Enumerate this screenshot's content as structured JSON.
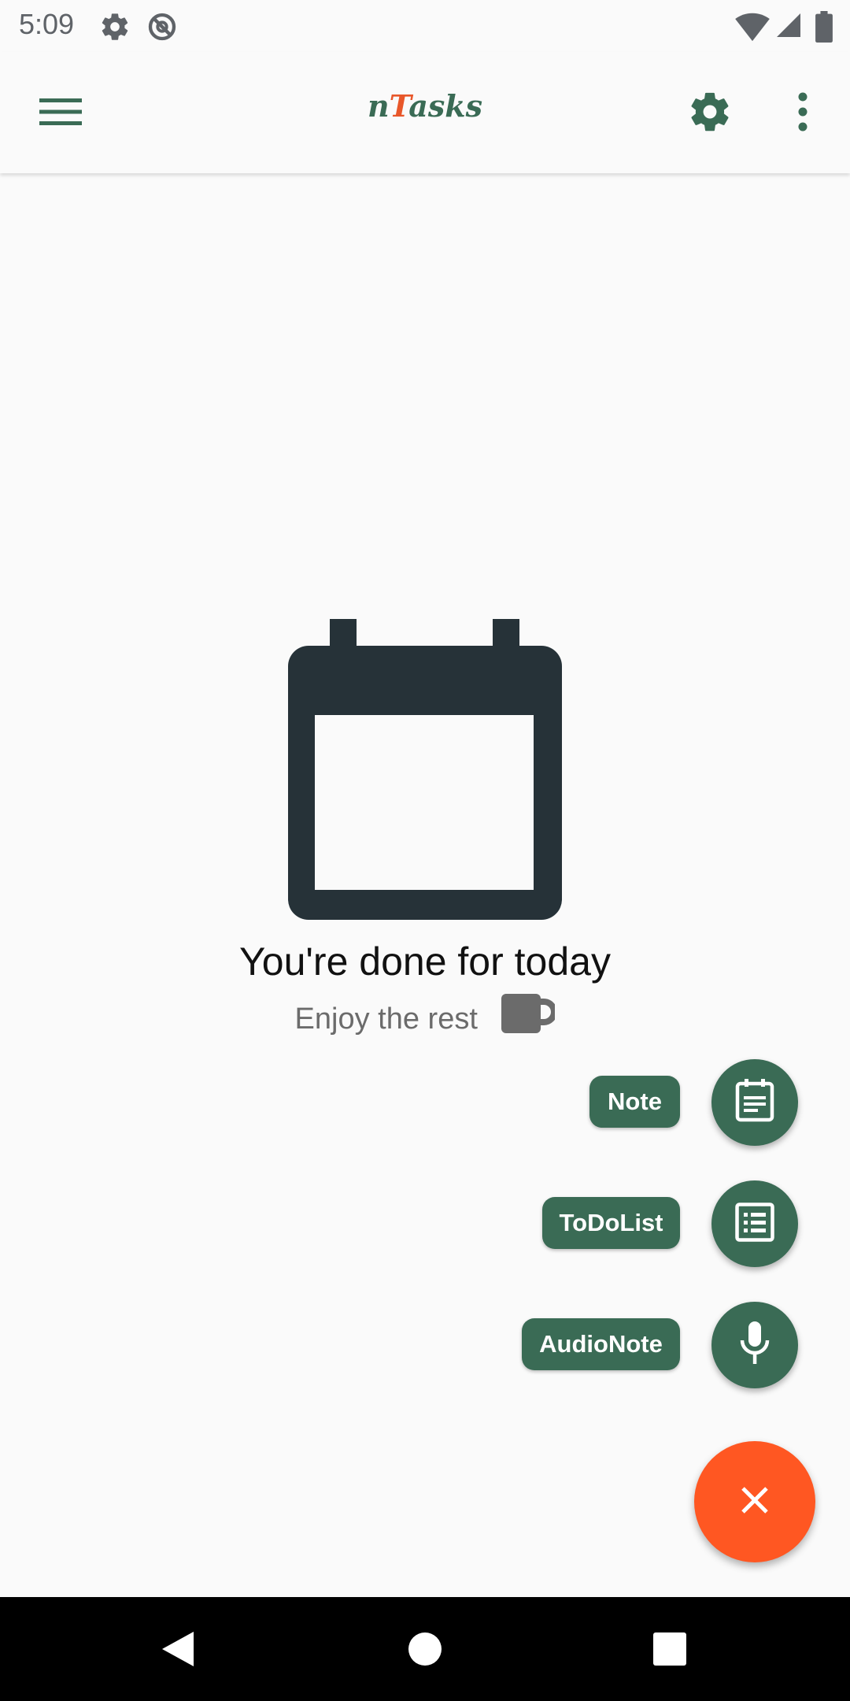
{
  "status_bar": {
    "time": "5:09",
    "icons": [
      "settings-icon",
      "no-sync-icon",
      "wifi-icon",
      "signal-icon",
      "battery-icon"
    ]
  },
  "app_bar": {
    "title_first": "n",
    "title_accent": "T",
    "title_rest": "asks",
    "menu_icon": "hamburger-menu-icon",
    "settings_icon": "gear-icon",
    "overflow_icon": "more-vert-icon"
  },
  "empty_state": {
    "icon": "calendar-icon",
    "title": "You're done for today",
    "subtitle": "Enjoy the rest",
    "subtitle_icon": "mug-icon"
  },
  "fab_menu": {
    "items": [
      {
        "label": "Note",
        "icon": "note-icon"
      },
      {
        "label": "ToDoList",
        "icon": "checklist-icon"
      },
      {
        "label": "AudioNote",
        "icon": "microphone-icon"
      }
    ],
    "close_icon": "close-icon"
  },
  "colors": {
    "primary": "#3a6b55",
    "accent": "#ff5722",
    "title_accent": "#e8572a",
    "icon_dark": "#263238"
  },
  "nav_bar": {
    "icons": [
      "back-icon",
      "home-icon",
      "recents-icon"
    ]
  }
}
